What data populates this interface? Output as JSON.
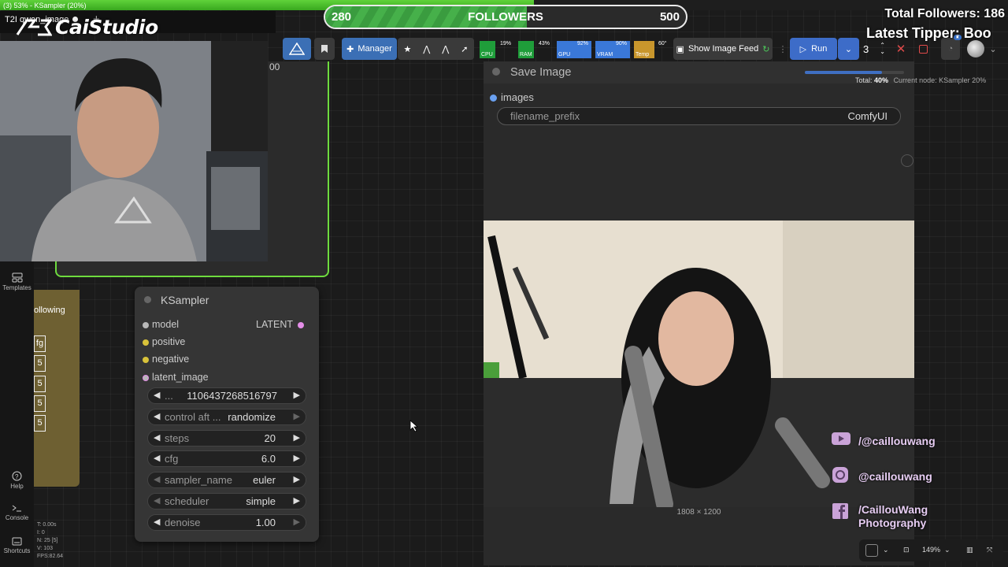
{
  "window": {
    "title": "(3) 53% - KSampler (20%)",
    "tab_title": "T2I qwen_image",
    "tab_plus": "+"
  },
  "logo": {
    "text": "CaiStudio"
  },
  "followers_goal": {
    "start": "280",
    "label": "FOLLOWERS",
    "end": "500",
    "progress": 0.56
  },
  "overlay": {
    "total_followers": "Total Followers: 186",
    "latest_tipper": "Latest Tipper: Boo"
  },
  "toolbar": {
    "manager_label": "Manager",
    "monitors": [
      {
        "name": "CPU",
        "value": "19%",
        "color": "#1f9d3a"
      },
      {
        "name": "RAM",
        "value": "43%",
        "color": "#1f9d3a"
      },
      {
        "name": "GPU",
        "value": "92%",
        "color": "#3a78d8"
      },
      {
        "name": "VRAM",
        "value": "90%",
        "color": "#3a78d8"
      },
      {
        "name": "Temp",
        "value": "60°",
        "color": "#c8962c"
      }
    ],
    "image_feed_label": "Show Image Feed",
    "run_label": "Run",
    "run_count": "3",
    "queue_badge": "2"
  },
  "hidden_node": {
    "value": "00"
  },
  "sidebar": {
    "templates_label": "Templates",
    "help_label": "Help",
    "console_label": "Console",
    "shortcuts_label": "Shortcuts"
  },
  "stats": {
    "t": "T: 0.00s",
    "i": "I: 0",
    "n": "N: 25 [5]",
    "v": "V: 103",
    "fps": "FPS:82.64"
  },
  "partial_node": {
    "title": "ollowing",
    "cells": [
      "fg",
      "5",
      "5",
      "5",
      "5"
    ]
  },
  "ksampler": {
    "title": "KSampler",
    "inputs": [
      {
        "label": "model",
        "color": "#b8b8b8"
      },
      {
        "label": "positive",
        "color": "#d8c23a"
      },
      {
        "label": "negative",
        "color": "#d8c23a"
      },
      {
        "label": "latent_image",
        "color": "#e48ee8"
      }
    ],
    "output": {
      "label": "LATENT",
      "color": "#e48ee8"
    },
    "widgets": [
      {
        "label": "...",
        "value": "1106437268516797"
      },
      {
        "label": "control aft ...",
        "value": "randomize"
      },
      {
        "label": "steps",
        "value": "20"
      },
      {
        "label": "cfg",
        "value": "6.0"
      },
      {
        "label": "sampler_name",
        "value": "euler"
      },
      {
        "label": "scheduler",
        "value": "simple"
      },
      {
        "label": "denoise",
        "value": "1.00"
      }
    ]
  },
  "save_image": {
    "title": "Save Image",
    "input_label": "images",
    "prefix_label": "filename_prefix",
    "prefix_value": "ComfyUI",
    "dimensions": "1808 × 1200"
  },
  "progress": {
    "total_label": "Total:",
    "total_value": "40%",
    "node_label": "Current node: KSampler 20%",
    "fill": 0.78
  },
  "social": {
    "youtube": "/@caillouwang",
    "instagram": "@caillouwang",
    "facebook_line1": "/CaillouWang",
    "facebook_line2": "Photography"
  },
  "canvas_controls": {
    "zoom": "149%"
  }
}
